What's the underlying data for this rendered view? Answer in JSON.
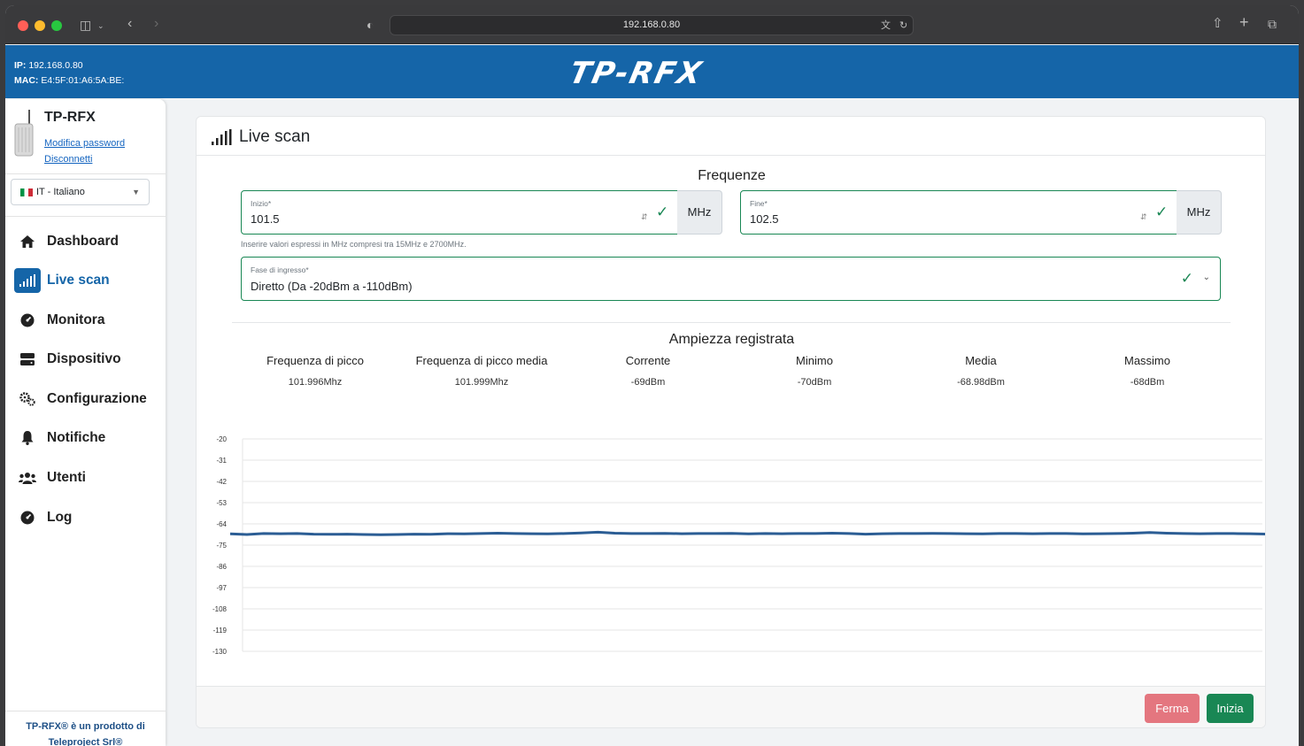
{
  "browser": {
    "url": "192.168.0.80"
  },
  "header": {
    "ip_label": "IP:",
    "ip_value": "192.168.0.80",
    "mac_label": "MAC:",
    "mac_value": "E4:5F:01:A6:5A:BE:",
    "logo_text": "TP-RFX"
  },
  "sidebar": {
    "device_name": "TP-RFX",
    "change_password": "Modifica password",
    "logout": "Disconnetti",
    "language": "IT - Italiano",
    "items": [
      {
        "label": "Dashboard",
        "icon": "home-icon"
      },
      {
        "label": "Live scan",
        "icon": "signal-icon"
      },
      {
        "label": "Monitora",
        "icon": "gauge-icon"
      },
      {
        "label": "Dispositivo",
        "icon": "server-icon"
      },
      {
        "label": "Configurazione",
        "icon": "gears-icon"
      },
      {
        "label": "Notifiche",
        "icon": "bell-icon"
      },
      {
        "label": "Utenti",
        "icon": "users-icon"
      },
      {
        "label": "Log",
        "icon": "gauge-icon"
      }
    ],
    "active_item": "Live scan",
    "footer_line1": "TP-RFX® è un prodotto di",
    "footer_line2": "Teleproject Srl®"
  },
  "main": {
    "title": "Live scan",
    "frequencies_title": "Frequenze",
    "start": {
      "label": "Inizio*",
      "value": "101.5",
      "unit": "MHz"
    },
    "end": {
      "label": "Fine*",
      "value": "102.5",
      "unit": "MHz"
    },
    "help_text": "Inserire valori espressi in MHz compresi tra 15MHz e 2700MHz.",
    "input_stage": {
      "label": "Fase di ingresso*",
      "value": "Diretto (Da -20dBm a -110dBm)"
    },
    "amplitude_title": "Ampiezza registrata",
    "stats": [
      {
        "label": "Frequenza di picco",
        "value": "101.996Mhz"
      },
      {
        "label": "Frequenza di picco media",
        "value": "101.999Mhz"
      },
      {
        "label": "Corrente",
        "value": "-69dBm"
      },
      {
        "label": "Minimo",
        "value": "-70dBm"
      },
      {
        "label": "Media",
        "value": "-68.98dBm"
      },
      {
        "label": "Massimo",
        "value": "-68dBm"
      }
    ],
    "buttons": {
      "stop": "Ferma",
      "start": "Inizia"
    }
  },
  "chart_data": {
    "type": "line",
    "title": "",
    "xlabel": "",
    "ylabel": "",
    "yticks": [
      "-20",
      "-31",
      "-42",
      "-53",
      "-64",
      "-75",
      "-86",
      "-97",
      "-108",
      "-119",
      "-130"
    ],
    "ylim": [
      -130,
      -20
    ],
    "grid": true,
    "series": [
      {
        "color": "#2b5d94",
        "values": [
          -69.2,
          -69.5,
          -69.0,
          -69.1,
          -69.0,
          -69.3,
          -69.4,
          -69.3,
          -69.5,
          -69.6,
          -69.5,
          -69.3,
          -69.4,
          -69.1,
          -69.2,
          -69.0,
          -68.8,
          -69.0,
          -69.1,
          -69.2,
          -69.0,
          -68.7,
          -68.3,
          -68.8,
          -69.0,
          -69.0,
          -68.9,
          -69.1,
          -69.0,
          -69.0,
          -68.9,
          -69.2,
          -69.0,
          -69.1,
          -69.0,
          -69.0,
          -68.8,
          -69.0,
          -69.3,
          -69.1,
          -69.0,
          -69.0,
          -68.9,
          -69.0,
          -69.1,
          -69.2,
          -69.0,
          -69.0,
          -69.1,
          -69.0,
          -69.0,
          -69.2,
          -69.1,
          -69.0,
          -68.8,
          -68.5,
          -68.8,
          -69.0,
          -69.1,
          -69.0,
          -69.0,
          -69.1,
          -69.3
        ]
      }
    ]
  }
}
